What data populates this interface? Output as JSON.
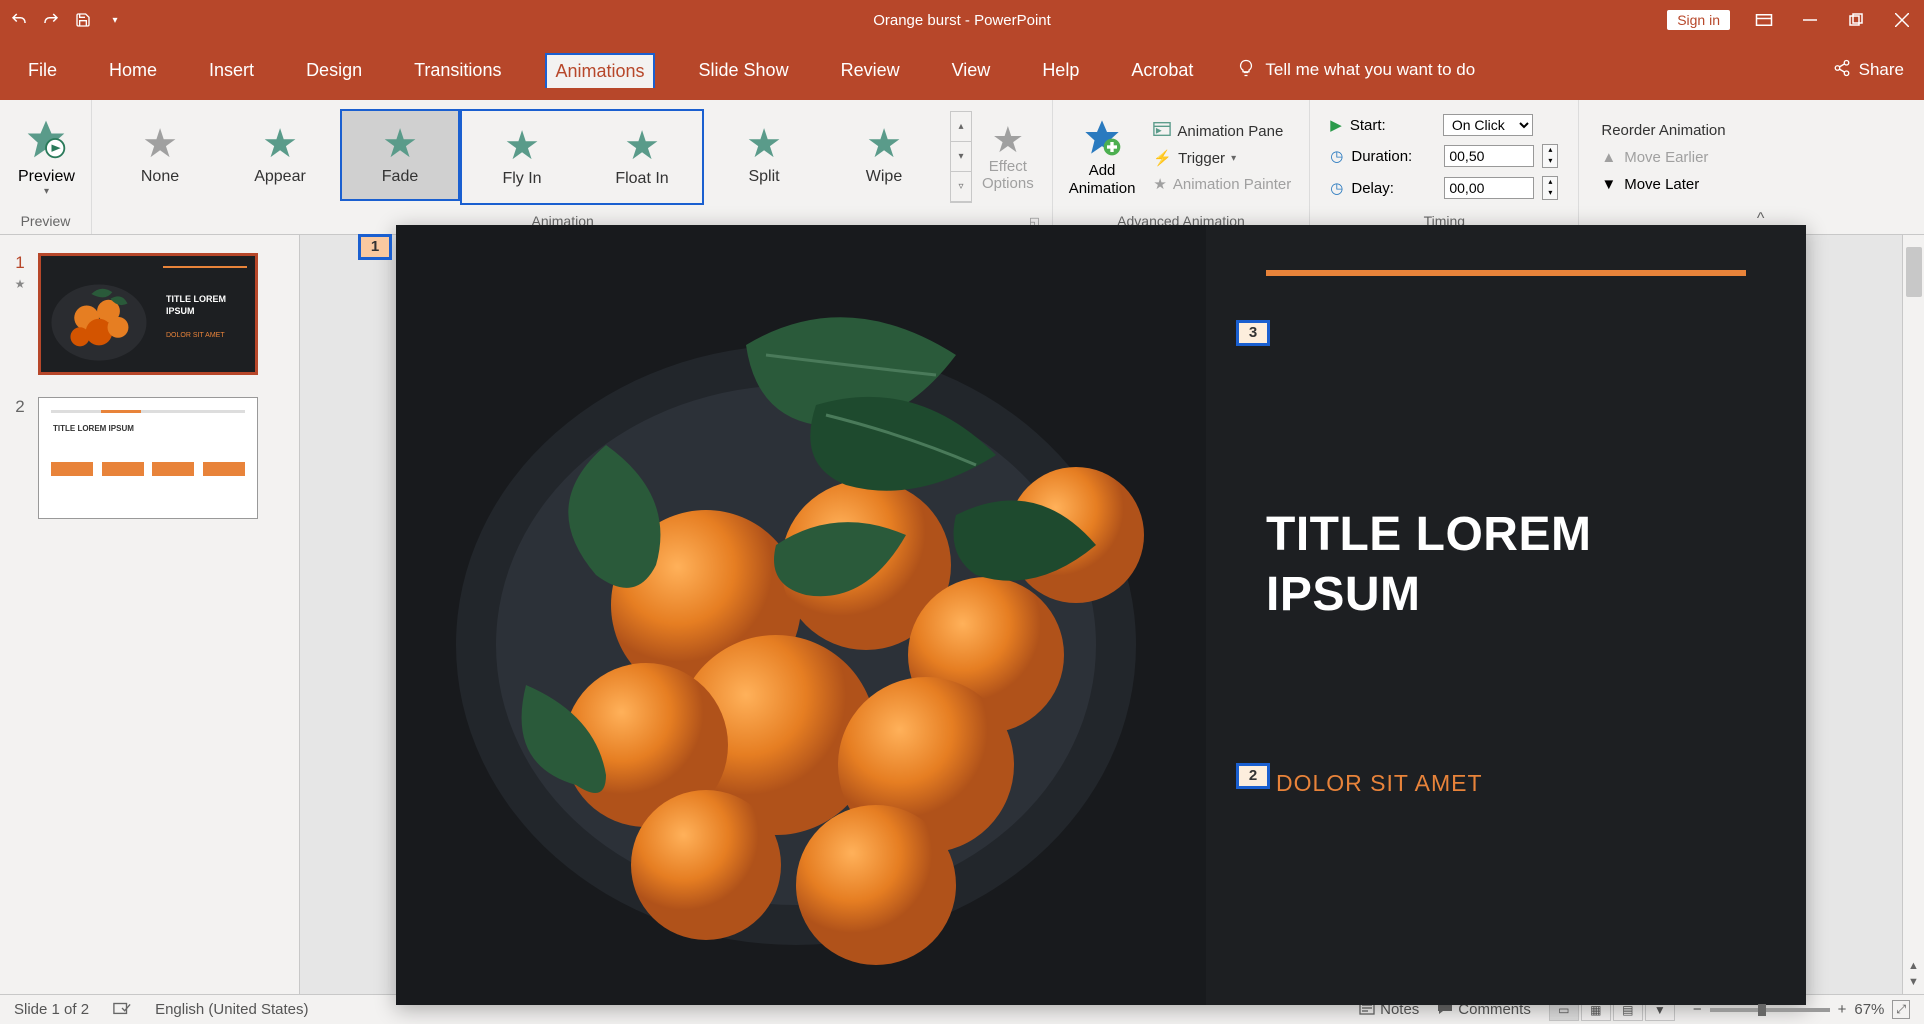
{
  "titlebar": {
    "title": "Orange burst  -  PowerPoint",
    "signin": "Sign in"
  },
  "tabs": {
    "file": "File",
    "home": "Home",
    "insert": "Insert",
    "design": "Design",
    "transitions": "Transitions",
    "animations": "Animations",
    "slideshow": "Slide Show",
    "review": "Review",
    "view": "View",
    "help": "Help",
    "acrobat": "Acrobat",
    "tellme": "Tell me what you want to do",
    "share": "Share"
  },
  "ribbon": {
    "preview_group": "Preview",
    "preview_btn": "Preview",
    "animation_group": "Animation",
    "items": {
      "none": "None",
      "appear": "Appear",
      "fade": "Fade",
      "flyin": "Fly In",
      "floatin": "Float In",
      "split": "Split",
      "wipe": "Wipe"
    },
    "effect_options": "Effect\nOptions",
    "advanced_group": "Advanced Animation",
    "add_animation": "Add\nAnimation",
    "anim_pane": "Animation Pane",
    "trigger": "Trigger",
    "anim_painter": "Animation Painter",
    "timing_group": "Timing",
    "start_lbl": "Start:",
    "start_val": "On Click",
    "duration_lbl": "Duration:",
    "duration_val": "00,50",
    "delay_lbl": "Delay:",
    "delay_val": "00,00",
    "reorder_hdr": "Reorder Animation",
    "move_earlier": "Move Earlier",
    "move_later": "Move Later"
  },
  "thumbs": {
    "n1": "1",
    "n2": "2",
    "t1_title": "TITLE LOREM\nIPSUM",
    "t1_sub": "DOLOR SIT AMET",
    "t2_h": "TITLE LOREM IPSUM"
  },
  "slide": {
    "title": "TITLE LOREM\nIPSUM",
    "subtitle": "DOLOR SIT AMET",
    "tag1": "1",
    "tag2": "2",
    "tag3": "3"
  },
  "statusbar": {
    "slide_info": "Slide 1 of 2",
    "lang": "English (United States)",
    "notes": "Notes",
    "comments": "Comments",
    "zoom_pct": "67%"
  }
}
